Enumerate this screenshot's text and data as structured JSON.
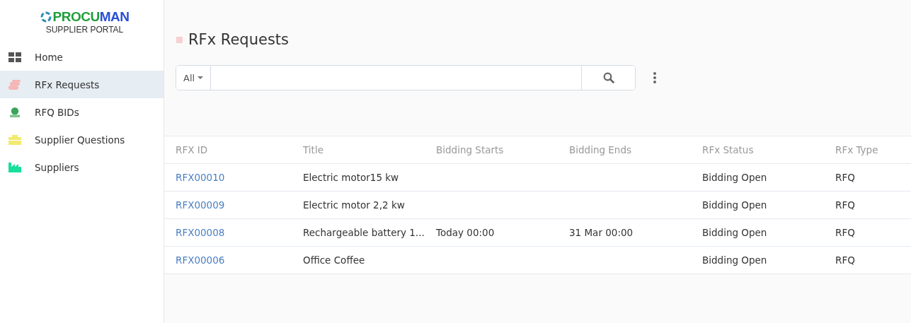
{
  "logo": {
    "brand_a": "PROCU",
    "brand_b": "MAN",
    "subtitle": "SUPPLIER PORTAL"
  },
  "sidebar": {
    "items": [
      {
        "label": "Home",
        "selected": false
      },
      {
        "label": "RFx Requests",
        "selected": true
      },
      {
        "label": "RFQ BIDs",
        "selected": false
      },
      {
        "label": "Supplier Questions",
        "selected": false
      },
      {
        "label": "Suppliers",
        "selected": false
      }
    ]
  },
  "page_title": "RFx Requests",
  "search": {
    "filter": "All"
  },
  "table": {
    "columns": [
      "RFX ID",
      "Title",
      "Bidding Starts",
      "Bidding Ends",
      "RFx Status",
      "RFx Type"
    ],
    "rows": [
      [
        "RFX00010",
        "Electric motor15 kw",
        "",
        "",
        "Bidding Open",
        "RFQ"
      ],
      [
        "RFX00009",
        "Electric motor 2,2 kw",
        "",
        "",
        "Bidding Open",
        "RFQ"
      ],
      [
        "RFX00008",
        "Rechargeable battery 1...",
        "Today 00:00",
        "31 Mar 00:00",
        "Bidding Open",
        "RFQ"
      ],
      [
        "RFX00006",
        "Office Coffee",
        "",
        "",
        "Bidding Open",
        "RFQ"
      ]
    ]
  }
}
